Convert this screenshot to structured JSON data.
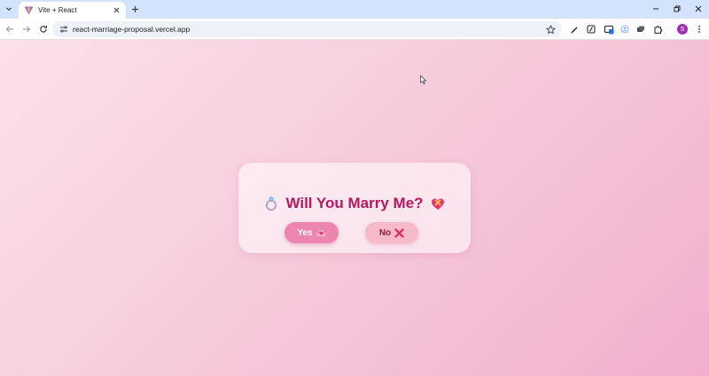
{
  "browser": {
    "tab_title": "Vite + React",
    "url": "react-marriage-proposal.vercel.app",
    "profile_initial": "S"
  },
  "page": {
    "headline": "Will You Marry Me?",
    "yes_button": "Yes",
    "no_button": "No"
  },
  "colors": {
    "headline": "#b3195e",
    "yes_button_bg": "#ec85b0",
    "no_button_bg": "#f6bac9",
    "page_gradient": [
      "#fbe1ea",
      "#f1afcd"
    ]
  },
  "icons": {
    "headline_left": "ring-icon",
    "headline_right": "heart-ribbon-icon",
    "yes_emoji": "love-letter-icon",
    "no_emoji": "cross-mark-icon"
  }
}
